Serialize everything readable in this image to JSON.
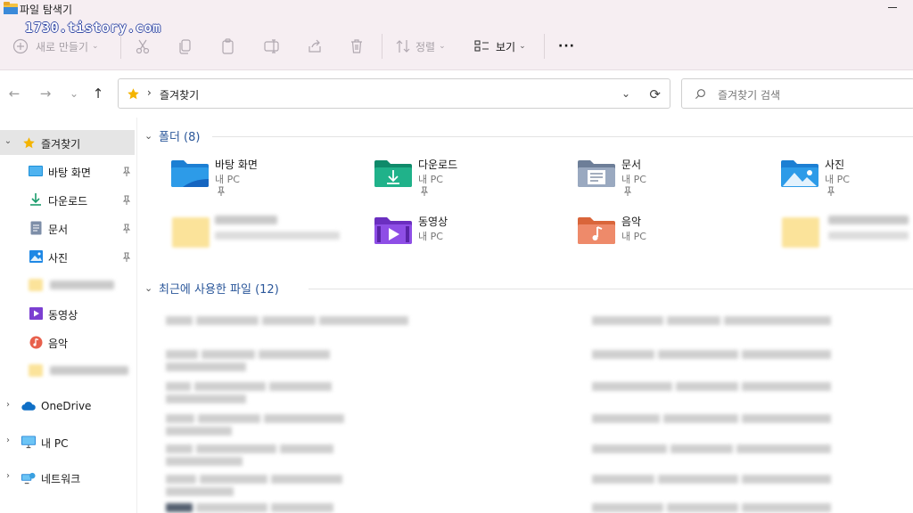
{
  "window": {
    "title": "파일 탐색기",
    "watermark": "1730.tistory.com"
  },
  "ribbon": {
    "new_label": "새로 만들기",
    "sort_label": "정렬",
    "view_label": "보기",
    "more_label": "···",
    "icons": [
      "new-icon",
      "cut-icon",
      "copy-icon",
      "paste-icon",
      "rename-icon",
      "share-icon",
      "delete-icon",
      "sort-icon",
      "view-icon",
      "more-icon"
    ]
  },
  "nav": {
    "back": "←",
    "forward": "→",
    "recent": "⌄",
    "up": "↑"
  },
  "address": {
    "separator": "›",
    "path": "즐겨찾기",
    "dropdown": "⌄",
    "refresh": "⟳"
  },
  "search": {
    "placeholder": "즐겨찾기 검색"
  },
  "sidebar": {
    "quick_access": {
      "label": "즐겨찾기",
      "chevron": "⌄"
    },
    "items": [
      {
        "label": "바탕 화면",
        "icon": "desktop-icon",
        "pinned": true
      },
      {
        "label": "다운로드",
        "icon": "download-icon",
        "pinned": true
      },
      {
        "label": "문서",
        "icon": "document-icon",
        "pinned": true
      },
      {
        "label": "사진",
        "icon": "picture-icon",
        "pinned": true
      },
      {
        "label": "",
        "icon": "folder-icon",
        "pinned": false,
        "blurred": true
      },
      {
        "label": "동영상",
        "icon": "video-icon",
        "pinned": false
      },
      {
        "label": "음악",
        "icon": "music-icon",
        "pinned": false
      },
      {
        "label": "",
        "icon": "folder-icon",
        "pinned": false,
        "blurred": true
      }
    ],
    "onedrive": {
      "label": "OneDrive",
      "chevron": "›"
    },
    "this_pc": {
      "label": "내 PC",
      "chevron": "›"
    },
    "network": {
      "label": "네트워크",
      "chevron": "›"
    },
    "pin_glyph": "📌"
  },
  "main": {
    "folders_section": {
      "title": "폴더 (8)",
      "chevron": "⌄"
    },
    "folders": [
      {
        "name": "바탕 화면",
        "location": "내 PC",
        "pinned": true,
        "icon": "desktop-folder-icon"
      },
      {
        "name": "다운로드",
        "location": "내 PC",
        "pinned": true,
        "icon": "download-folder-icon"
      },
      {
        "name": "문서",
        "location": "내 PC",
        "pinned": true,
        "icon": "document-folder-icon"
      },
      {
        "name": "사진",
        "location": "내 PC",
        "pinned": true,
        "icon": "picture-folder-icon"
      },
      {
        "name": "",
        "location": "",
        "pinned": false,
        "icon": "folder-icon",
        "blurred": true
      },
      {
        "name": "동영상",
        "location": "내 PC",
        "pinned": false,
        "icon": "video-folder-icon"
      },
      {
        "name": "음악",
        "location": "내 PC",
        "pinned": false,
        "icon": "music-folder-icon"
      },
      {
        "name": "",
        "location": "",
        "pinned": false,
        "icon": "folder-icon",
        "blurred": true
      }
    ],
    "recent_section": {
      "title": "최근에 사용한 파일 (12)",
      "chevron": "⌄"
    }
  },
  "colors": {
    "ribbon_bg": "#f6eef2",
    "section_title": "#2b579a",
    "selected_bg": "#e5e5e5",
    "star": "#f4b400"
  }
}
